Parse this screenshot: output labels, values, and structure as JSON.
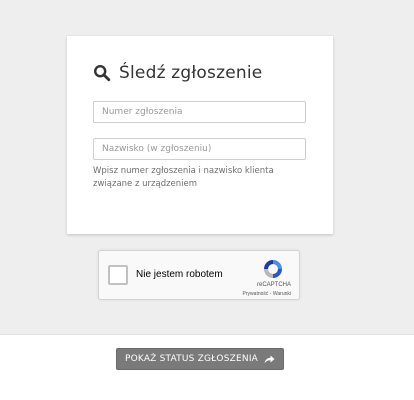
{
  "form": {
    "title": "Śledź zgłoszenie",
    "title_icon": "search-icon",
    "ticket_number": {
      "placeholder": "Numer zgłoszenia",
      "value": ""
    },
    "surname": {
      "placeholder": "Nazwisko (w zgłoszeniu)",
      "value": ""
    },
    "hint": "Wpisz numer zgłoszenia i nazwisko klienta związane z urządzeniem"
  },
  "recaptcha": {
    "checkbox_label": "Nie jestem robotem",
    "checked": false,
    "brand": "reCAPTCHA",
    "privacy_link": "Prywatność",
    "separator": " - ",
    "terms_link": "Warunki",
    "logo_icon": "recaptcha-logo-icon"
  },
  "actions": {
    "submit_label": "POKAŻ STATUS ZGŁOSZENIA",
    "submit_icon": "share-arrow-icon"
  },
  "colors": {
    "background": "#eeeeee",
    "card": "#ffffff",
    "button": "#7a7a7a"
  }
}
